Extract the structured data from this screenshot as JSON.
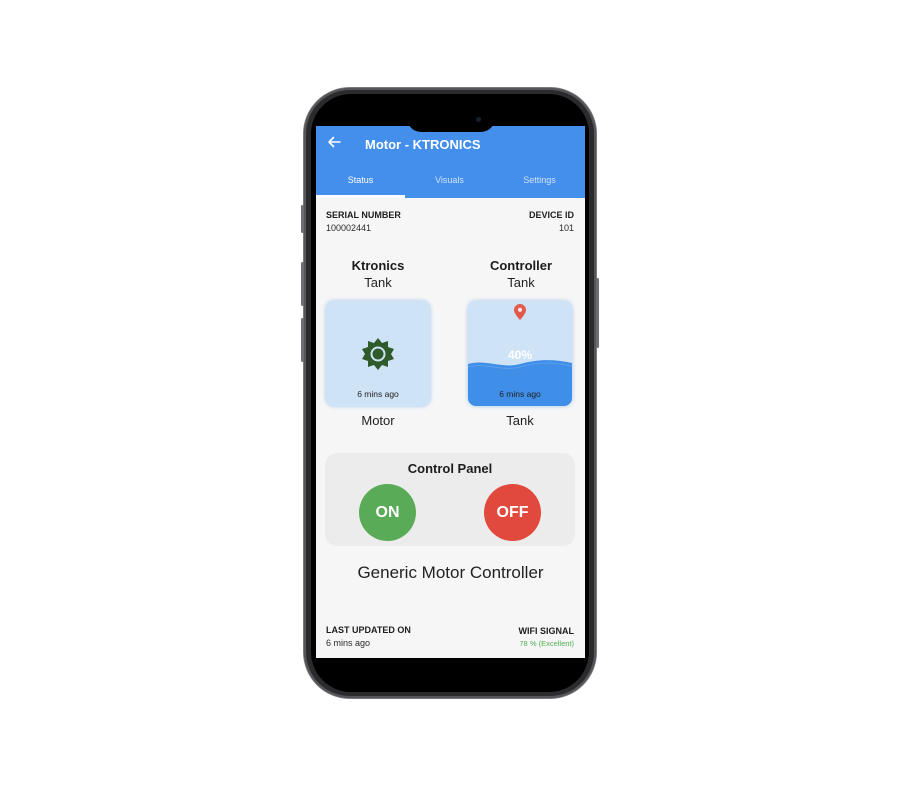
{
  "app": {
    "title": "Motor - KTRONICS",
    "back_icon": "arrow-left-icon"
  },
  "tabs": [
    {
      "label": "Status",
      "active": true
    },
    {
      "label": "Visuals",
      "active": false
    },
    {
      "label": "Settings",
      "active": false
    }
  ],
  "info": {
    "serial_label": "SERIAL NUMBER",
    "serial_value": "100002441",
    "device_id_label": "DEVICE ID",
    "device_id_value": "101"
  },
  "columns": {
    "left": {
      "title": "Ktronics",
      "subtitle": "Tank"
    },
    "right": {
      "title": "Controller",
      "subtitle": "Tank"
    }
  },
  "tiles": {
    "motor": {
      "icon": "gear-icon",
      "time": "6 mins ago",
      "caption": "Motor"
    },
    "tank": {
      "icon": "location-pin-icon",
      "percent": "40%",
      "level": 0.4,
      "time": "6 mins ago",
      "caption": "Tank"
    }
  },
  "control_panel": {
    "title": "Control Panel",
    "on_label": "ON",
    "off_label": "OFF"
  },
  "device_name": "Generic Motor Controller",
  "footer": {
    "last_updated_label": "LAST UPDATED ON",
    "last_updated_value": "6 mins ago",
    "wifi_label": "WIFI SIGNAL",
    "wifi_value": "78 % (Excellent)"
  },
  "colors": {
    "appbar": "#448eec",
    "on": "#5aab58",
    "off": "#e2493d",
    "wifi_good": "#4fae54",
    "pin": "#e35a4a"
  }
}
